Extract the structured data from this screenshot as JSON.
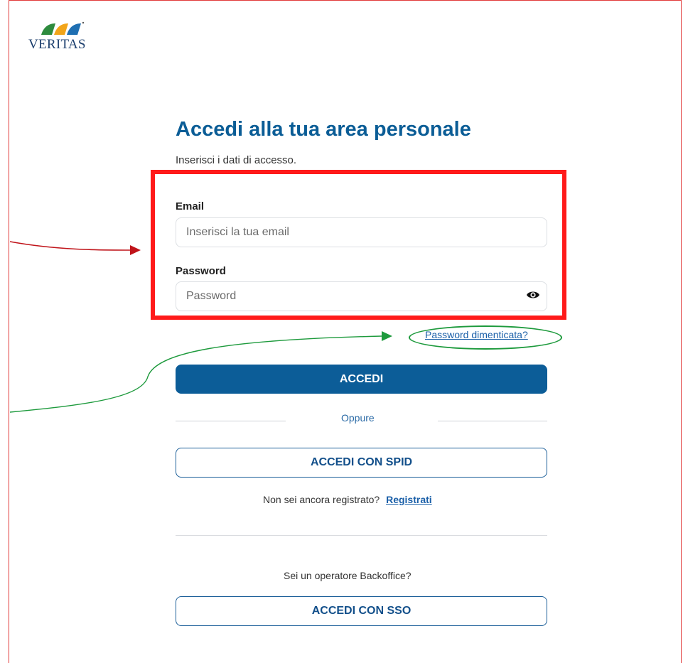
{
  "brand": {
    "logo_text": "VERITAS",
    "colors": {
      "wave1": "#2e8b3e",
      "wave2": "#f2a51a",
      "wave3": "#1f6fb2"
    }
  },
  "page": {
    "title": "Accedi alla tua area personale",
    "subtitle": "Inserisci i dati di accesso."
  },
  "form": {
    "email_label": "Email",
    "email_placeholder": "Inserisci la tua email",
    "email_value": "",
    "password_label": "Password",
    "password_placeholder": "Password",
    "password_value": "",
    "password_toggle_icon": "eye-icon",
    "forgot_link": "Password dimenticata?",
    "submit_label": "ACCEDI"
  },
  "alternatives": {
    "divider_text": "Oppure",
    "spid_button": "ACCEDI CON SPID",
    "not_registered_text": "Non sei ancora registrato?",
    "register_link": "Registrati",
    "backoffice_text": "Sei un operatore Backoffice?",
    "sso_button": "ACCEDI CON SSO"
  },
  "annotations": {
    "highlight_color": "#ff1a1a",
    "forgot_ellipse_color": "#1d9a3c",
    "red_arrow_color": "#c0141a",
    "green_arrow_color": "#1d9a3c"
  },
  "colors": {
    "primary": "#0c5d98",
    "title": "#0b5d96",
    "link": "#1a5fa8"
  }
}
